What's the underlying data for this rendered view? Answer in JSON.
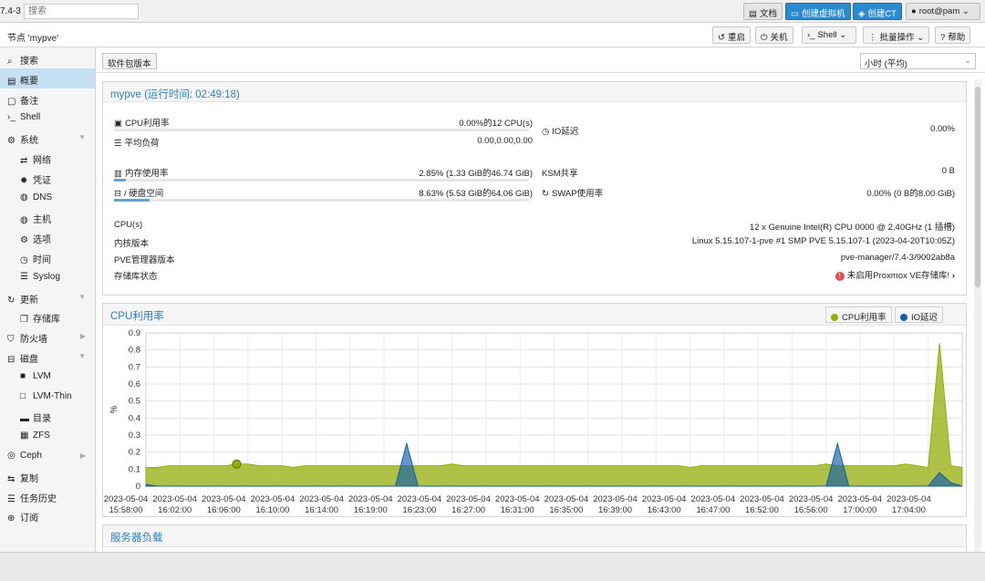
{
  "topbar": {
    "version": "7.4-3",
    "search_placeholder": "搜索",
    "docs": "文档",
    "create_vm": "创建虚拟机",
    "create_ct": "创建CT",
    "user": "root@pam"
  },
  "nodebar": {
    "title": "节点 'mypve'",
    "reboot": "重启",
    "shutdown": "关机",
    "shell": "Shell",
    "bulk": "批量操作",
    "help": "帮助"
  },
  "sidebar": {
    "items": [
      {
        "label": "搜索"
      },
      {
        "label": "概要"
      },
      {
        "label": "备注"
      },
      {
        "label": "Shell"
      },
      {
        "label": "系统"
      },
      {
        "label": "网络"
      },
      {
        "label": "凭证"
      },
      {
        "label": "DNS"
      },
      {
        "label": "主机"
      },
      {
        "label": "选项"
      },
      {
        "label": "时间"
      },
      {
        "label": "Syslog"
      },
      {
        "label": "更新"
      },
      {
        "label": "存储库"
      },
      {
        "label": "防火墙"
      },
      {
        "label": "磁盘"
      },
      {
        "label": "LVM"
      },
      {
        "label": "LVM-Thin"
      },
      {
        "label": "目录"
      },
      {
        "label": "ZFS"
      },
      {
        "label": "Ceph"
      },
      {
        "label": "复制"
      },
      {
        "label": "任务历史"
      },
      {
        "label": "订阅"
      }
    ]
  },
  "toolbar": {
    "pkg_versions": "软件包版本",
    "timeframe": "小时 (平均)"
  },
  "status": {
    "header": "mypve (运行时间: 02:49:18)",
    "cpu_label": "CPU利用率",
    "cpu_value": "0.00%的12 CPU(s)",
    "cpu_usage": 0.0,
    "io_label": "IO延迟",
    "io_value": "0.00%",
    "load_label": "平均负荷",
    "load_value": "0.00,0.00,0.00",
    "mem_label": "内存使用率",
    "mem_value": "2.85% (1.33 GiB的46.74 GiB)",
    "mem_usage": 0.0285,
    "ksm_label": "KSM共享",
    "ksm_value": "0 B",
    "disk_label": "/ 硬盘空间",
    "disk_value": "8.63% (5.53 GiB的64.06 GiB)",
    "disk_usage": 0.0863,
    "swap_label": "SWAP使用率",
    "swap_value": "0.00% (0 B的8.00 GiB)",
    "cpus_label": "CPU(s)",
    "cpus_value": "12 x Genuine Intel(R) CPU 0000 @ 2.40GHz (1 插槽)",
    "kernel_label": "内核版本",
    "kernel_value": "Linux 5.15.107-1-pve #1 SMP PVE 5.15.107-1 (2023-04-20T10:05Z)",
    "pve_label": "PVE管理器版本",
    "pve_value": "pve-manager/7.4-3/9002ab8a",
    "repo_label": "存储库状态",
    "repo_value": "未启用Proxmox VE存储库!"
  },
  "cpu_panel": {
    "header": "CPU利用率"
  },
  "load_panel": {
    "header": "服务器负载"
  },
  "colors": {
    "cpu": "#94ae0a",
    "io": "#115fa6"
  },
  "chart_data": {
    "type": "area",
    "ylabel": "%",
    "ylim": [
      0,
      0.9
    ],
    "yticks": [
      "0",
      "0.1",
      "0.2",
      "0.3",
      "0.4",
      "0.5",
      "0.6",
      "0.7",
      "0.8",
      "0.9"
    ],
    "xticks": [
      {
        "date": "2023-05-04",
        "time": "15:58:00"
      },
      {
        "date": "2023-05-04",
        "time": "16:02:00"
      },
      {
        "date": "2023-05-04",
        "time": "16:06:00"
      },
      {
        "date": "2023-05-04",
        "time": "16:10:00"
      },
      {
        "date": "2023-05-04",
        "time": "16:14:00"
      },
      {
        "date": "2023-05-04",
        "time": "16:19:00"
      },
      {
        "date": "2023-05-04",
        "time": "16:23:00"
      },
      {
        "date": "2023-05-04",
        "time": "16:27:00"
      },
      {
        "date": "2023-05-04",
        "time": "16:31:00"
      },
      {
        "date": "2023-05-04",
        "time": "16:35:00"
      },
      {
        "date": "2023-05-04",
        "time": "16:39:00"
      },
      {
        "date": "2023-05-04",
        "time": "16:43:00"
      },
      {
        "date": "2023-05-04",
        "time": "16:47:00"
      },
      {
        "date": "2023-05-04",
        "time": "16:52:00"
      },
      {
        "date": "2023-05-04",
        "time": "16:56:00"
      },
      {
        "date": "2023-05-04",
        "time": "17:00:00"
      },
      {
        "date": "2023-05-04",
        "time": "17:04:00"
      }
    ],
    "series": [
      {
        "name": "CPU利用率",
        "values": [
          0.11,
          0.11,
          0.12,
          0.12,
          0.12,
          0.12,
          0.12,
          0.12,
          0.13,
          0.13,
          0.12,
          0.12,
          0.12,
          0.11,
          0.12,
          0.12,
          0.12,
          0.12,
          0.12,
          0.12,
          0.12,
          0.12,
          0.12,
          0.12,
          0.12,
          0.12,
          0.12,
          0.13,
          0.12,
          0.12,
          0.12,
          0.12,
          0.12,
          0.12,
          0.12,
          0.12,
          0.12,
          0.12,
          0.12,
          0.12,
          0.12,
          0.12,
          0.12,
          0.12,
          0.12,
          0.12,
          0.12,
          0.12,
          0.11,
          0.12,
          0.12,
          0.12,
          0.12,
          0.12,
          0.12,
          0.12,
          0.12,
          0.12,
          0.12,
          0.12,
          0.13,
          0.12,
          0.12,
          0.12,
          0.12,
          0.12,
          0.12,
          0.13,
          0.12,
          0.11,
          0.84,
          0.12,
          0.11
        ]
      },
      {
        "name": "IO延迟",
        "values": [
          0.01,
          0.0,
          0.0,
          0.0,
          0.0,
          0.0,
          0.0,
          0.0,
          0.0,
          0.0,
          0.0,
          0.0,
          0.0,
          0.0,
          0.0,
          0.0,
          0.0,
          0.0,
          0.0,
          0.0,
          0.0,
          0.0,
          0.0,
          0.25,
          0.0,
          0.0,
          0.0,
          0.0,
          0.0,
          0.0,
          0.0,
          0.0,
          0.0,
          0.0,
          0.0,
          0.0,
          0.0,
          0.0,
          0.0,
          0.0,
          0.0,
          0.0,
          0.0,
          0.0,
          0.0,
          0.0,
          0.0,
          0.0,
          0.0,
          0.0,
          0.0,
          0.0,
          0.0,
          0.0,
          0.0,
          0.0,
          0.0,
          0.0,
          0.0,
          0.0,
          0.0,
          0.25,
          0.0,
          0.0,
          0.0,
          0.0,
          0.0,
          0.0,
          0.0,
          0.0,
          0.08,
          0.02,
          0.0
        ]
      }
    ],
    "grid": true
  }
}
